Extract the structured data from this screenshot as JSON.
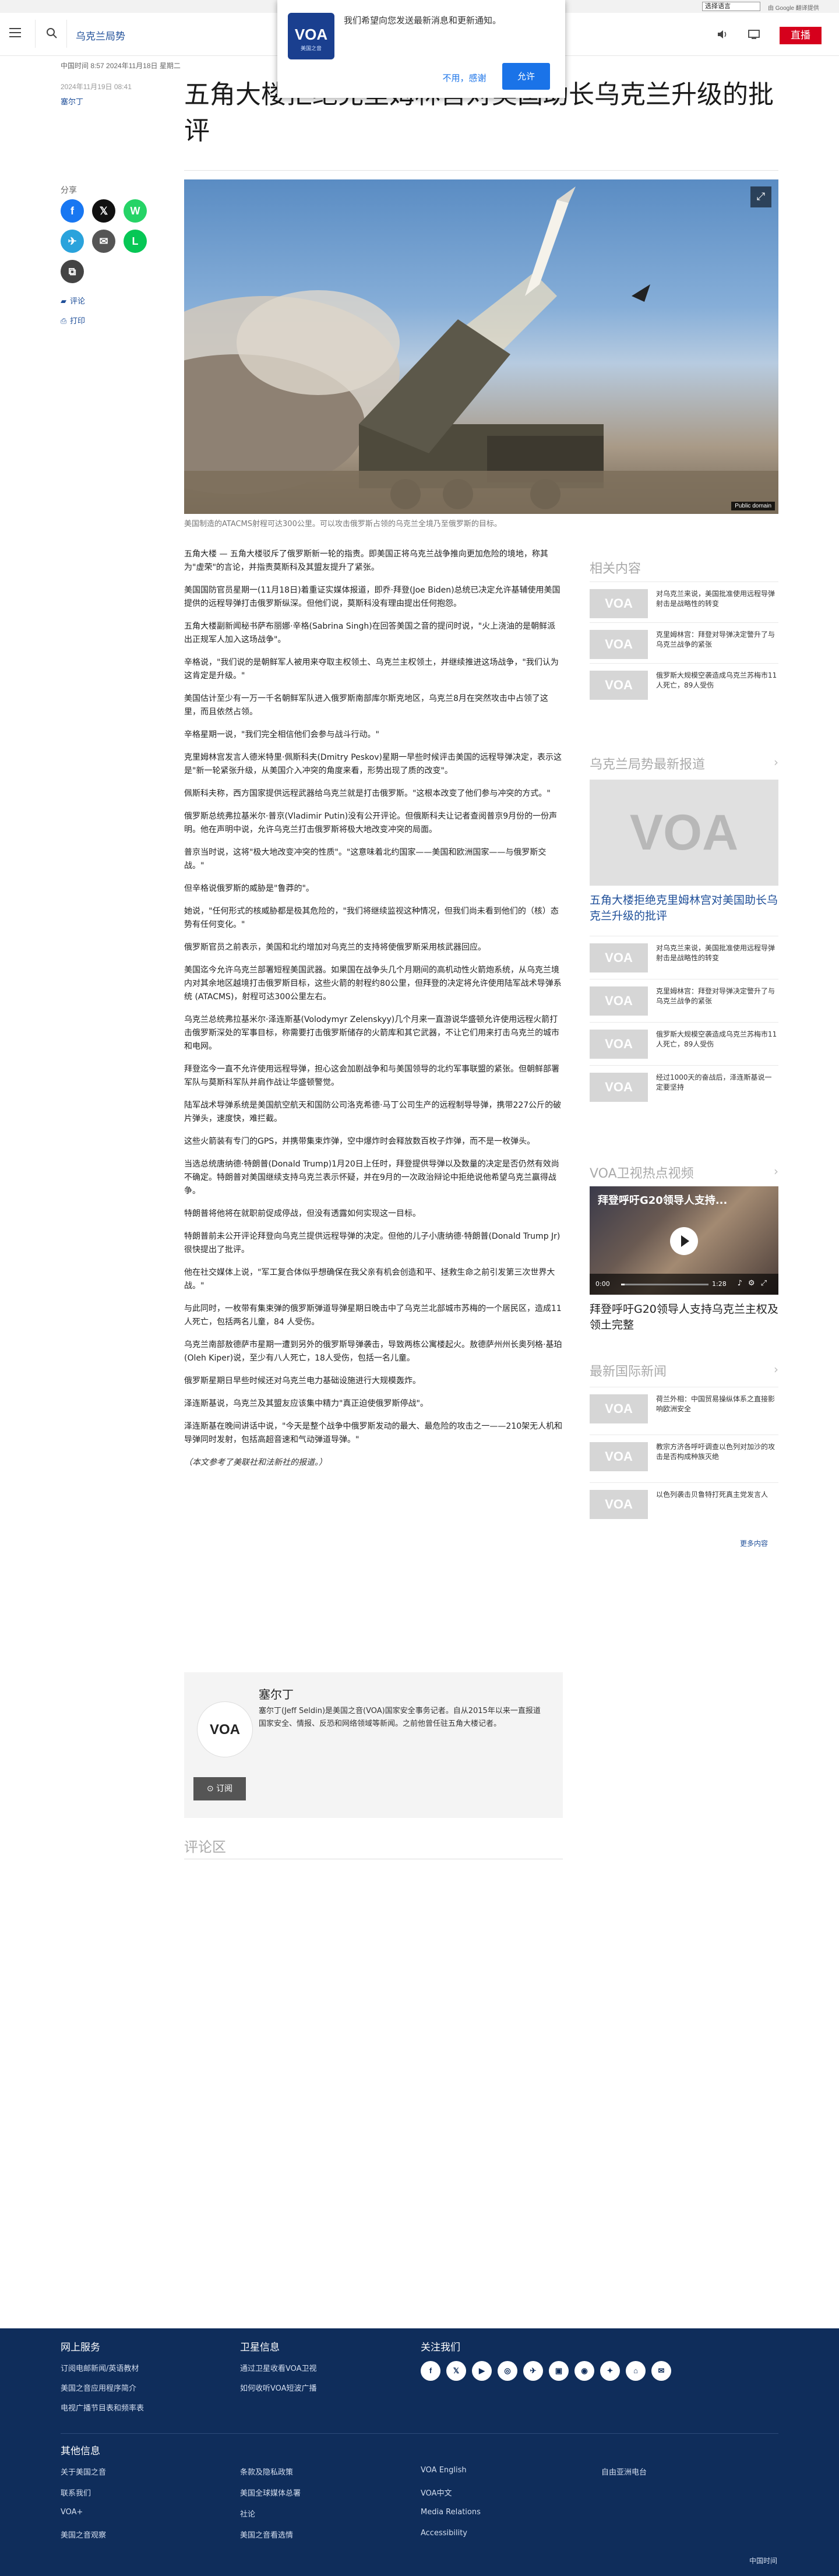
{
  "utility": {
    "language_select": "选择语言",
    "powered_by": "由 Google 翻译提供"
  },
  "header": {
    "section_name": "乌克兰局势",
    "live_label": "直播"
  },
  "notification": {
    "logo_text": "VOA",
    "logo_sub": "美国之音",
    "message": "我们希望向您发送最新消息和更新通知。",
    "decline": "不用，感谢",
    "accept": "允许"
  },
  "article": {
    "date_line": "中国时间 8:57 2024年11月18日 星期二",
    "date_line2": "2024年11月19日 08:41",
    "author": "塞尔丁",
    "title": "五角大楼拒绝克里姆林宫对美国助长乌克兰升级的批评",
    "caption": "美国制造的ATACMS射程可达300公里。可以攻击俄罗斯占领的乌克兰全境乃至俄罗斯的目标。",
    "image_credit": "Public domain",
    "paragraphs": [
      "五角大楼 — 五角大楼驳斥了俄罗斯新一轮的指责。即美国正将乌克兰战争推向更加危险的境地，称其为\"虚荣\"的言论，并指责莫斯科及其盟友提升了紧张。",
      "美国国防官员星期一(11月18日)着重证实媒体报道，即乔·拜登(Joe Biden)总统已决定允许基辅使用美国提供的远程导弹打击俄罗斯纵深。但他们说，莫斯科没有理由提出任何抱怨。",
      "五角大楼副新闻秘书萨布丽娜·辛格(Sabrina Singh)在回答美国之音的提问时说，\"火上浇油的是朝鲜派出正规军人加入这场战争\"。",
      "辛格说，\"我们说的是朝鲜军人被用来夺取主权领土、乌克兰主权领土，并继续推进这场战争，\"我们认为这肯定是升级。\"",
      "美国估计至少有一万一千名朝鲜军队进入俄罗斯南部库尔斯克地区，乌克兰8月在突然攻击中占领了这里，而且依然占领。",
      "辛格星期一说，\"我们完全相信他们会参与战斗行动。\"",
      "克里姆林宫发言人德米特里·佩斯科夫(Dmitry Peskov)星期一早些时候评击美国的远程导弹决定，表示这是\"新一轮紧张升级，从美国介入冲突的角度来看，形势出现了质的改变\"。",
      "佩斯科夫称，西方国家提供远程武器给乌克兰就是打击俄罗斯。\"这根本改变了他们参与冲突的方式。\"",
      "俄罗斯总统弗拉基米尔·普京(Vladimir Putin)没有公开评论。但俄斯科夫让记者查阅普京9月份的一份声明。他在声明中说，允许乌克兰打击俄罗斯将极大地改变冲突的局面。",
      "普京当时说，这将\"极大地改变冲突的性质\"。\"这意味着北约国家——美国和欧洲国家——与俄罗斯交战。\"",
      "但辛格说俄罗斯的威胁是\"鲁莽的\"。",
      "她说，\"任何形式的核威胁都是极其危险的，\"我们将继续监视这种情况，但我们尚未看到他们的（核）态势有任何变化。\"",
      "俄罗斯官员之前表示，美国和北约增加对乌克兰的支持将使俄罗斯采用核武器回应。",
      "美国迄今允许乌克兰部署短程美国武器。如果国在战争头几个月期间的高机动性火箭炮系统，从乌克兰境内对其余地区越境打击俄罗斯目标，这些火箭的射程约80公里，但拜登的决定将允许使用陆军战术导弹系统 (ATACMS)，射程可达300公里左右。",
      "乌克兰总统弗拉基米尔·泽连斯基(Volodymyr Zelenskyy)几个月来一直游说华盛顿允许使用远程火箭打击俄罗斯深处的军事目标，称需要打击俄罗斯储存的火箭库和其它武器，不让它们用来打击乌克兰的城市和电网。",
      "拜登迄今一直不允许使用远程导弹，担心这会加剧战争和与美国领导的北约军事联盟的紧张。但朝鲜部署军队与莫斯科军队并肩作战让华盛顿警觉。",
      "陆军战术导弹系统是美国航空航天和国防公司洛克希德·马丁公司生产的远程制导导弹，携带227公斤的破片弹头，速度快，难拦截。",
      "这些火箭装有专门的GPS，并携带集束炸弹，空中爆炸时会释放数百枚子炸弹，而不是一枚弹头。",
      "当选总统唐纳德·特朗普(Donald Trump)1月20日上任时，拜登提供导弹以及数量的决定是否仍然有效尚不确定。特朗普对美国继续支持乌克兰表示怀疑，并在9月的一次政治辩论中拒绝说他希望乌克兰赢得战争。",
      "特朗普将他将在就职前促成停战，但没有透露如何实现这一目标。",
      "特朗普前未公开评论拜登向乌克兰提供远程导弹的决定。但他的儿子小唐纳德·特朗普(Donald Trump Jr)很快提出了批评。",
      "他在社交媒体上说，\"军工复合体似乎想确保在我父亲有机会创造和平、拯救生命之前引发第三次世界大战。\"",
      "与此同时，一枚带有集束弹的俄罗斯弹道导弹星期日晚击中了乌克兰北部城市苏梅的一个居民区，造成11人死亡，包括两名儿童，84 人受伤。",
      "乌克兰南部敖德萨市星期一遭到另外的俄罗斯导弹袭击，导致两栋公寓楼起火。敖德萨州州长奥列格·基珀(Oleh Kiper)说，至少有八人死亡，18人受伤，包括一名儿童。",
      "俄罗斯星期日早些时候还对乌克兰电力基础设施进行大规模轰炸。",
      "泽连斯基说，乌克兰及其盟友应该集中精力\"真正迫使俄罗斯停战\"。",
      "泽连斯基在晚间讲话中说，\"今天是整个战争中俄罗斯发动的最大、最危险的攻击之一——210架无人机和导弹同时发射，包括高超音速和气动弹道导弹。\"",
      "（本文参考了美联社和法新社的报道。）"
    ]
  },
  "share": {
    "label": "分享",
    "buttons": [
      "f",
      "𝕏",
      "W",
      "✈",
      "✉",
      "L",
      "⧉"
    ],
    "comment_label": "评论",
    "print_label": "打印"
  },
  "author_box": {
    "avatar_text": "VOA",
    "name": "塞尔丁",
    "bio": "塞尔丁(Jeff Seldin)是美国之音(VOA)国家安全事务记者。自从2015年以来一直报道国家安全、情报、反恐和网络领域等新闻。之前他曾任驻五角大楼记者。",
    "subscribe": "订阅"
  },
  "comments": {
    "title": "评论区"
  },
  "sidebar": {
    "related_heading": "相关内容",
    "related": [
      "对乌克兰来说，美国批准使用远程导弹射击是战略性的转变",
      "克里姆林宫：拜登对导弹决定警升了与乌克兰战争的紧张",
      "俄罗斯大规模空袭造成乌克兰苏梅市11人死亡，89人受伤"
    ],
    "ukraine_heading": "乌克兰局势最新报道",
    "big_thumb": "VOA",
    "big_title": "五角大楼拒绝克里姆林宫对美国助长乌克兰升级的批评",
    "ukraine": [
      "对乌克兰来说，美国批准使用远程导弹射击是战略性的转变",
      "克里姆林宫：拜登对导弹决定警升了与乌克兰战争的紧张",
      "俄罗斯大规模空袭造成乌克兰苏梅市11人死亡，89人受伤",
      "经过1000天的奋战后，泽连斯基说一定要坚持"
    ],
    "video_heading": "VOA卫视热点视频",
    "video_overlay": "拜登呼吁G20领导人支持...",
    "video_time_current": "0:00",
    "video_time_total": "1:28",
    "video_progress": 0.04,
    "video_caption": "拜登呼吁G20领导人支持乌克兰主权及领土完整",
    "intl_heading": "最新国际新闻",
    "intl": [
      "荷兰外相：中国贸易操纵体系之直接影响欧洲安全",
      "教宗方济各呼吁调查以色列对加沙的攻击是否构成种族灭绝",
      "以色列袭击贝鲁特打死真主党发言人"
    ],
    "more": "更多内容"
  },
  "footer": {
    "online_heading": "网上服务",
    "online_links": [
      "订阅电邮新闻/英语教材",
      "美国之音应用程序简介",
      "电视广播节目表和频率表"
    ],
    "satellite_heading": "卫星信息",
    "satellite_links": [
      "通过卫星收看VOA卫视",
      "如何收听VOA短波广播"
    ],
    "follow_heading": "关注我们",
    "social_icons": [
      "f",
      "𝕏",
      "▶",
      "◎",
      "✈",
      "▣",
      "◉",
      "✦",
      "⌂",
      "✉"
    ],
    "other_heading": "其他信息",
    "other_links": [
      [
        "关于美国之音",
        "条款及隐私政策",
        "VOA English",
        "自由亚洲电台"
      ],
      [
        "联系我们",
        "美国全球媒体总署",
        "VOA中文",
        ""
      ],
      [
        "VOA+",
        "社论",
        "Media Relations",
        ""
      ],
      [
        "美国之音观察",
        "美国之音看选情",
        "Accessibility",
        ""
      ]
    ],
    "bottom": "中国时间"
  }
}
